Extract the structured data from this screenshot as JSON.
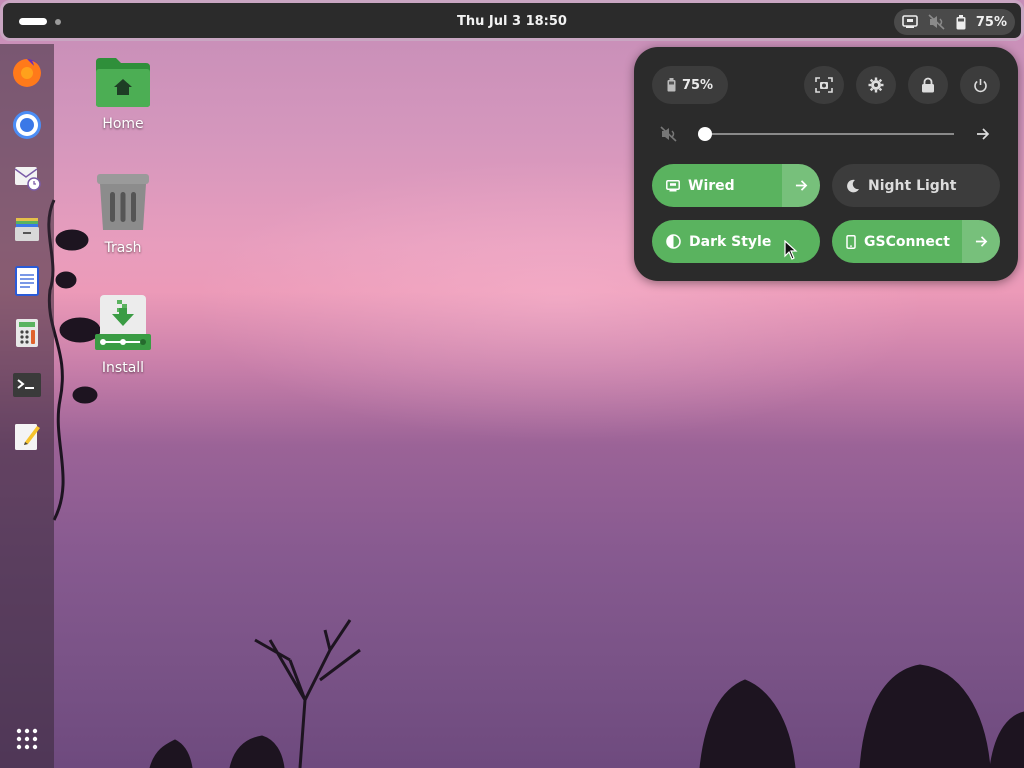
{
  "topbar": {
    "clock": "Thu Jul 3  18:50",
    "battery_percent": "75%",
    "icons": [
      "workspace-indicator",
      "network-wired-icon",
      "audio-muted-icon",
      "battery-icon"
    ]
  },
  "dock": {
    "apps": [
      "firefox-icon",
      "chromium-icon",
      "mail-client-icon",
      "files-icon",
      "writer-document-icon",
      "calculator-icon",
      "terminal-icon",
      "text-editor-icon",
      "app-grid-icon"
    ]
  },
  "desktop": {
    "icons": [
      {
        "label": "Home",
        "icon": "home-folder-icon"
      },
      {
        "label": "Trash",
        "icon": "trash-icon"
      },
      {
        "label": "Install",
        "icon": "installer-icon"
      }
    ]
  },
  "quick_settings": {
    "battery_label": "75%",
    "buttons": [
      "screenshot-icon",
      "settings-icon",
      "lock-icon",
      "power-icon"
    ],
    "volume": {
      "muted": true,
      "level": 0.0
    },
    "toggles": [
      {
        "label": "Wired",
        "state": "on",
        "has_arrow": true,
        "icon": "network-wired-icon"
      },
      {
        "label": "Night Light",
        "state": "off",
        "has_arrow": false,
        "icon": "moon-icon"
      },
      {
        "label": "Dark Style",
        "state": "on",
        "has_arrow": false,
        "icon": "dark-style-icon"
      },
      {
        "label": "GSConnect",
        "state": "on",
        "has_arrow": true,
        "icon": "phone-icon"
      }
    ]
  },
  "colors": {
    "accent": "#5ab35f",
    "panel": "#2b2b2b",
    "chip": "#3c3c3c"
  }
}
